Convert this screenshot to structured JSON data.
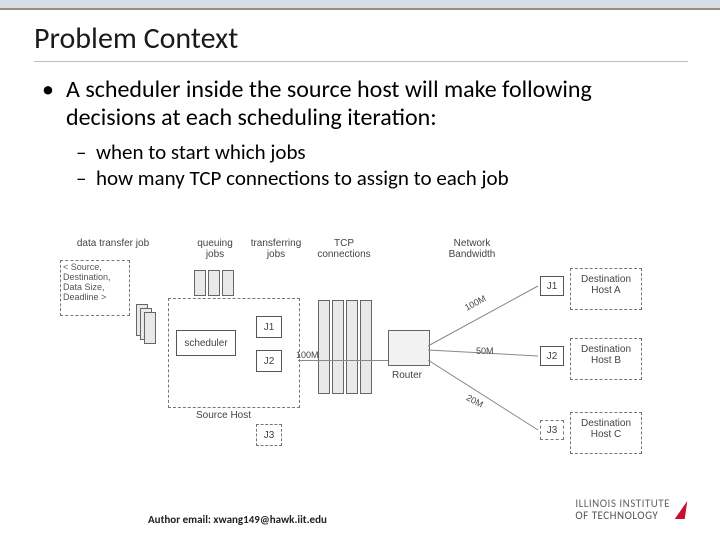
{
  "title": "Problem Context",
  "bullets": {
    "main": "A scheduler inside the source host will make following decisions at each scheduling iteration:",
    "sub1": "when to start which jobs",
    "sub2": "how many TCP connections to assign to each job"
  },
  "diagram": {
    "job_spec": "< Source,\nDestination,\nData Size,\nDeadline >",
    "col_data_transfer": "data transfer job",
    "col_queuing": "queuing\njobs",
    "col_transferring": "transferring\njobs",
    "col_tcp": "TCP\nconnections",
    "col_network": "Network\nBandwidth",
    "scheduler": "scheduler",
    "source_host": "Source Host",
    "router": "Router",
    "dest_a": "Destination\nHost A",
    "dest_b": "Destination\nHost B",
    "dest_c": "Destination\nHost C",
    "j1": "J1",
    "j2": "J2",
    "j3": "J3",
    "bw100m_1": "100M",
    "bw100m_2": "100M",
    "bw50m": "50M",
    "bw20m": "20M"
  },
  "footer": {
    "email_label": "Author email: xwang149@hawk.iit.edu",
    "logo_line1": "ILLINOIS INSTITUTE",
    "logo_line2": "OF TECHNOLOGY"
  }
}
